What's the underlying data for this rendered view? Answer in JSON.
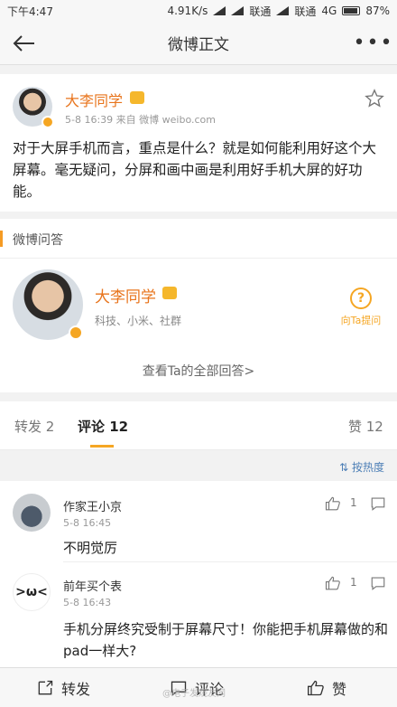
{
  "status_bar": {
    "time": "下午4:47",
    "network_speed": "4.91K/s",
    "carrier1": "联通",
    "carrier2": "联通",
    "network": "4G",
    "battery": "87%"
  },
  "nav": {
    "title": "微博正文",
    "back_icon": "back-arrow-icon",
    "more_icon": "more-icon"
  },
  "post": {
    "author": "大李同学",
    "meta": "5-8 16:39  来自 微博 weibo.com",
    "content": "对于大屏手机而言，重点是什么？就是如何能利用好这个大屏幕。毫无疑问，分屏和画中画是利用好手机大屏的好功能。"
  },
  "qa": {
    "section_title": "微博问答",
    "author": "大李同学",
    "tags": "科技、小米、社群",
    "ask_label": "向Ta提问",
    "view_all": "查看Ta的全部回答>"
  },
  "tabs": {
    "repost": "转发 2",
    "comments": "评论 12",
    "likes": "赞 12"
  },
  "sort_label": "按热度",
  "comments": [
    {
      "name": "作家王小京",
      "time": "5-8 16:45",
      "text": "不明觉厉",
      "likes": "1"
    },
    {
      "name": "前年买个表",
      "time": "5-8 16:43",
      "text": "手机分屏终究受制于屏幕尺寸！你能把手机屏幕做的和pad一样大?",
      "likes": "1"
    }
  ],
  "bottom": {
    "repost": "转发",
    "comment": "评论",
    "like": "赞"
  },
  "watermark": "@电子发烧友网",
  "colors": {
    "accent": "#f5a623",
    "name_orange": "#e8741c",
    "link_blue": "#4d7fb6"
  }
}
